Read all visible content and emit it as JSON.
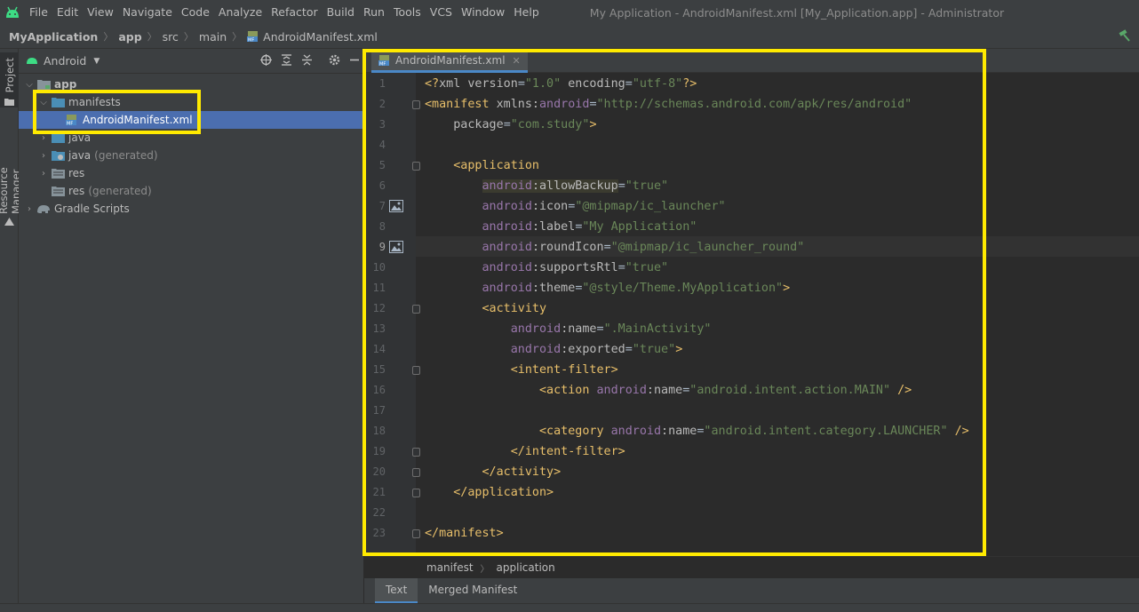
{
  "colors": {
    "tag": "#e8bf6a",
    "attr": "#bababa",
    "namespace": "#9876aa",
    "string": "#6a8759",
    "text": "#a9b7c6",
    "highlight_box": "#ffea00",
    "selection": "#4b6eaf"
  },
  "menu": {
    "items": [
      "File",
      "Edit",
      "View",
      "Navigate",
      "Code",
      "Analyze",
      "Refactor",
      "Build",
      "Run",
      "Tools",
      "VCS",
      "Window",
      "Help"
    ],
    "window_title": "My Application - AndroidManifest.xml [My_Application.app] - Administrator"
  },
  "navbar": {
    "crumbs": [
      "MyApplication",
      "app",
      "src",
      "main",
      "AndroidManifest.xml"
    ]
  },
  "left_strip": {
    "project_tab": "Project",
    "resource_manager_tab": "Resource Manager"
  },
  "project_panel": {
    "view_mode": "Android",
    "tree": [
      {
        "label": "app",
        "sub": "",
        "icon": "module-folder-icon"
      },
      {
        "label": "manifests",
        "sub": "",
        "icon": "folder-icon"
      },
      {
        "label": "AndroidManifest.xml",
        "sub": "",
        "icon": "manifest-file-icon"
      },
      {
        "label": "java",
        "sub": "",
        "icon": "folder-icon"
      },
      {
        "label": "java",
        "sub": "(generated)",
        "icon": "generated-folder-icon"
      },
      {
        "label": "res",
        "sub": "",
        "icon": "res-folder-icon"
      },
      {
        "label": "res",
        "sub": "(generated)",
        "icon": "res-folder-icon"
      },
      {
        "label": "Gradle Scripts",
        "sub": "",
        "icon": "gradle-icon"
      }
    ]
  },
  "editor": {
    "tab_label": "AndroidManifest.xml",
    "current_line": 9,
    "line_numbers": [
      "1",
      "2",
      "3",
      "4",
      "5",
      "6",
      "7",
      "8",
      "9",
      "10",
      "11",
      "12",
      "13",
      "14",
      "15",
      "16",
      "17",
      "18",
      "19",
      "20",
      "21",
      "22",
      "23"
    ],
    "lines": [
      [
        {
          "t": "<?",
          "c": "tag"
        },
        {
          "t": "xml version",
          "c": "attr"
        },
        {
          "t": "=",
          "c": "text"
        },
        {
          "t": "\"1.0\"",
          "c": "string"
        },
        {
          "t": " encoding",
          "c": "attr"
        },
        {
          "t": "=",
          "c": "text"
        },
        {
          "t": "\"utf-8\"",
          "c": "string"
        },
        {
          "t": "?>",
          "c": "tag"
        }
      ],
      [
        {
          "t": "<manifest ",
          "c": "tag"
        },
        {
          "t": "xmlns:",
          "c": "attr"
        },
        {
          "t": "android",
          "c": "namespace"
        },
        {
          "t": "=",
          "c": "text"
        },
        {
          "t": "\"http://schemas.android.com/apk/res/android\"",
          "c": "string"
        }
      ],
      [
        {
          "t": "    package",
          "c": "attr"
        },
        {
          "t": "=",
          "c": "text"
        },
        {
          "t": "\"com.study\"",
          "c": "string"
        },
        {
          "t": ">",
          "c": "tag"
        }
      ],
      [],
      [
        {
          "t": "    <application",
          "c": "tag"
        }
      ],
      [
        {
          "t": "        ",
          "c": "text"
        },
        {
          "t": "android",
          "c": "namespace"
        },
        {
          "t": ":allowBackup",
          "c": "attr"
        },
        {
          "t": "=",
          "c": "text"
        },
        {
          "t": "\"true\"",
          "c": "string"
        }
      ],
      [
        {
          "t": "        ",
          "c": "text"
        },
        {
          "t": "android",
          "c": "namespace"
        },
        {
          "t": ":icon",
          "c": "attr"
        },
        {
          "t": "=",
          "c": "text"
        },
        {
          "t": "\"@mipmap/ic_launcher\"",
          "c": "string"
        }
      ],
      [
        {
          "t": "        ",
          "c": "text"
        },
        {
          "t": "android",
          "c": "namespace"
        },
        {
          "t": ":label",
          "c": "attr"
        },
        {
          "t": "=",
          "c": "text"
        },
        {
          "t": "\"My Application\"",
          "c": "string"
        }
      ],
      [
        {
          "t": "        ",
          "c": "text"
        },
        {
          "t": "android",
          "c": "namespace"
        },
        {
          "t": ":roundIcon",
          "c": "attr"
        },
        {
          "t": "=",
          "c": "text"
        },
        {
          "t": "\"@mipmap/ic_launcher_round\"",
          "c": "string"
        }
      ],
      [
        {
          "t": "        ",
          "c": "text"
        },
        {
          "t": "android",
          "c": "namespace"
        },
        {
          "t": ":supportsRtl",
          "c": "attr"
        },
        {
          "t": "=",
          "c": "text"
        },
        {
          "t": "\"true\"",
          "c": "string"
        }
      ],
      [
        {
          "t": "        ",
          "c": "text"
        },
        {
          "t": "android",
          "c": "namespace"
        },
        {
          "t": ":theme",
          "c": "attr"
        },
        {
          "t": "=",
          "c": "text"
        },
        {
          "t": "\"@style/Theme.MyApplication\"",
          "c": "string"
        },
        {
          "t": ">",
          "c": "tag"
        }
      ],
      [
        {
          "t": "        <activity",
          "c": "tag"
        }
      ],
      [
        {
          "t": "            ",
          "c": "text"
        },
        {
          "t": "android",
          "c": "namespace"
        },
        {
          "t": ":name",
          "c": "attr"
        },
        {
          "t": "=",
          "c": "text"
        },
        {
          "t": "\".MainActivity\"",
          "c": "string"
        }
      ],
      [
        {
          "t": "            ",
          "c": "text"
        },
        {
          "t": "android",
          "c": "namespace"
        },
        {
          "t": ":exported",
          "c": "attr"
        },
        {
          "t": "=",
          "c": "text"
        },
        {
          "t": "\"true\"",
          "c": "string"
        },
        {
          "t": ">",
          "c": "tag"
        }
      ],
      [
        {
          "t": "            <intent-filter>",
          "c": "tag"
        }
      ],
      [
        {
          "t": "                <action ",
          "c": "tag"
        },
        {
          "t": "android",
          "c": "namespace"
        },
        {
          "t": ":name",
          "c": "attr"
        },
        {
          "t": "=",
          "c": "text"
        },
        {
          "t": "\"android.intent.action.MAIN\"",
          "c": "string"
        },
        {
          "t": " />",
          "c": "tag"
        }
      ],
      [],
      [
        {
          "t": "                <category ",
          "c": "tag"
        },
        {
          "t": "android",
          "c": "namespace"
        },
        {
          "t": ":name",
          "c": "attr"
        },
        {
          "t": "=",
          "c": "text"
        },
        {
          "t": "\"android.intent.category.LAUNCHER\"",
          "c": "string"
        },
        {
          "t": " />",
          "c": "tag"
        }
      ],
      [
        {
          "t": "            </intent-filter>",
          "c": "tag"
        }
      ],
      [
        {
          "t": "        </activity>",
          "c": "tag"
        }
      ],
      [
        {
          "t": "    </application>",
          "c": "tag"
        }
      ],
      [],
      [
        {
          "t": "</manifest>",
          "c": "tag"
        }
      ]
    ]
  },
  "breadcrumb": [
    "manifest",
    "application"
  ],
  "bottom_tabs": [
    "Text",
    "Merged Manifest"
  ]
}
